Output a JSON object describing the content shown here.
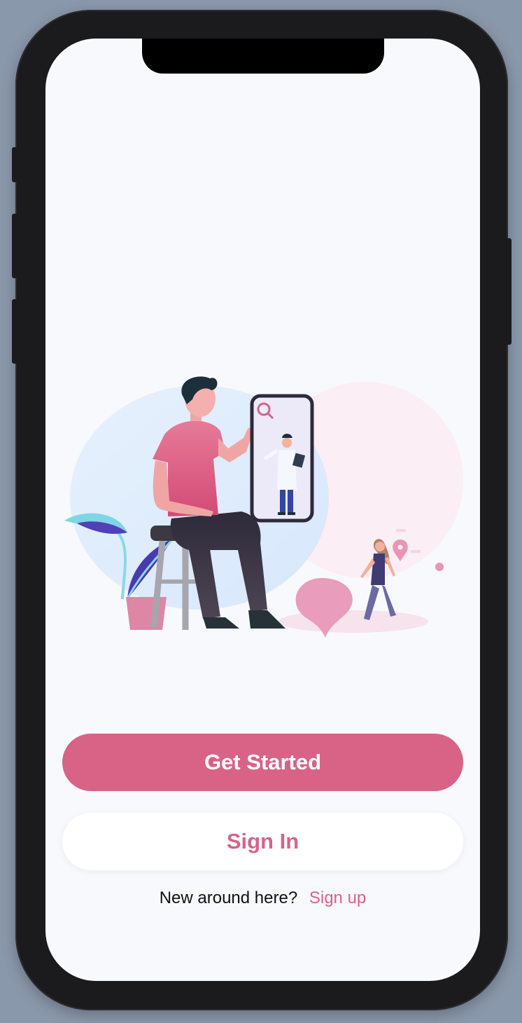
{
  "onboarding": {
    "illustration": "doctor-consultation-illustration",
    "get_started_label": "Get Started",
    "sign_in_label": "Sign In",
    "footer_prompt": "New around here?",
    "signup_link_label": "Sign up"
  },
  "colors": {
    "accent": "#d96287",
    "background": "#f8f9fc",
    "device_frame": "#1b1b1d",
    "page_background": "#8a98ab"
  }
}
